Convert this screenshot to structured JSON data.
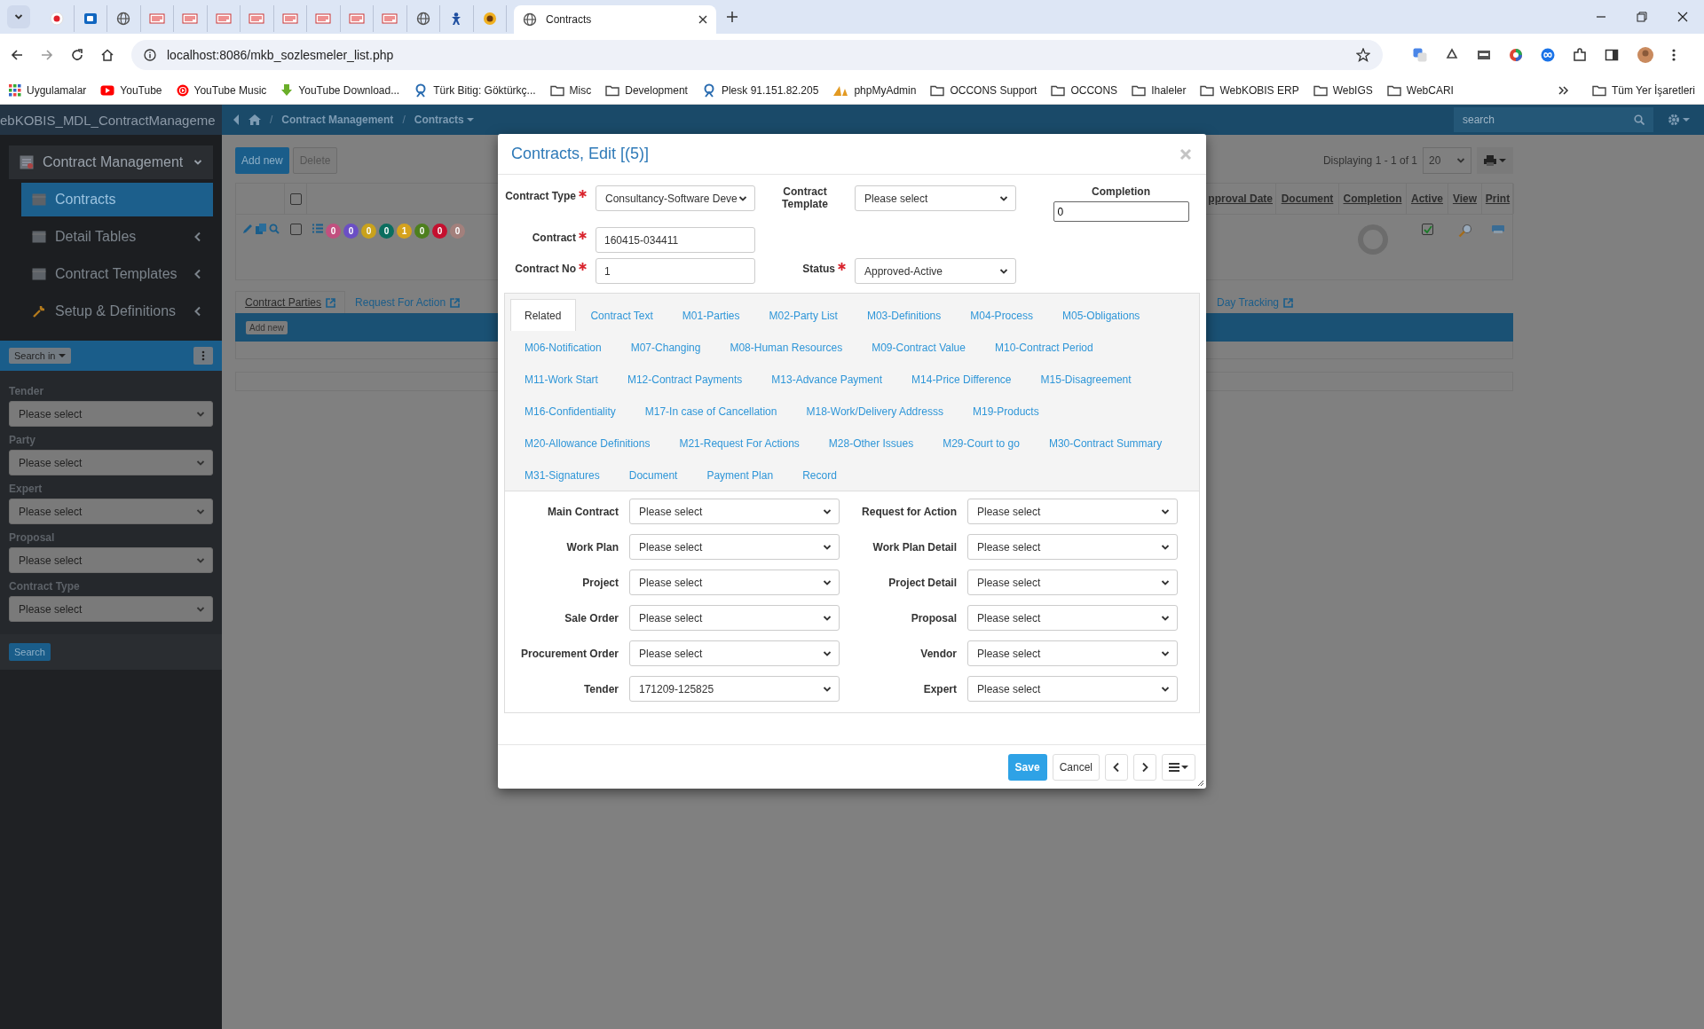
{
  "browser": {
    "tabs": [
      {
        "kind": "dot",
        "selected": false
      },
      {
        "kind": "mail",
        "selected": false
      },
      {
        "kind": "globe",
        "selected": false
      },
      {
        "kind": "logo",
        "selected": false
      },
      {
        "kind": "logo",
        "selected": false
      },
      {
        "kind": "logo",
        "selected": false
      },
      {
        "kind": "logo",
        "selected": false
      },
      {
        "kind": "logo",
        "selected": false
      },
      {
        "kind": "logo",
        "selected": false
      },
      {
        "kind": "logo",
        "selected": false
      },
      {
        "kind": "logo",
        "selected": false
      },
      {
        "kind": "globe",
        "selected": false
      },
      {
        "kind": "figure",
        "selected": false
      },
      {
        "kind": "emblem",
        "selected": false
      },
      {
        "kind": "globe",
        "title": "Contracts",
        "selected": true
      }
    ],
    "url": "localhost:8086/mkb_sozlesmeler_list.php",
    "bookmarks": [
      {
        "label": "Uygulamalar",
        "kind": "apps"
      },
      {
        "label": "YouTube",
        "kind": "video"
      },
      {
        "label": "YouTube Music",
        "kind": "music"
      },
      {
        "label": "YouTube Download...",
        "kind": "download"
      },
      {
        "label": "Türk Bitig: Göktürkç...",
        "kind": "site"
      },
      {
        "label": "Misc",
        "kind": "folder"
      },
      {
        "label": "Development",
        "kind": "folder"
      },
      {
        "label": "Plesk 91.151.82.205",
        "kind": "site"
      },
      {
        "label": "phpMyAdmin",
        "kind": "pma"
      },
      {
        "label": "OCCONS Support",
        "kind": "folder"
      },
      {
        "label": "OCCONS",
        "kind": "folder"
      },
      {
        "label": "Ihaleler",
        "kind": "folder"
      },
      {
        "label": "WebKOBIS ERP",
        "kind": "folder"
      },
      {
        "label": "WebIGS",
        "kind": "folder"
      },
      {
        "label": "WebCARI",
        "kind": "folder"
      }
    ],
    "all_bookmarks": "Tüm Yer İşaretleri"
  },
  "app": {
    "title": "ebKOBIS_MDL_ContractManageme",
    "breadcrumb": [
      "Contract Management",
      "Contracts"
    ],
    "separators": [
      "/",
      "/"
    ],
    "search": {
      "placeholder": "search"
    }
  },
  "sidebar": {
    "menu": [
      {
        "label": "Contract Management",
        "expanded": true,
        "children": [
          {
            "label": "Contracts",
            "kind": "table",
            "selected": true
          },
          {
            "label": "Detail Tables",
            "kind": "table",
            "selected": false,
            "expanded": false
          },
          {
            "label": "Contract Templates",
            "kind": "table",
            "selected": false,
            "expanded": false
          },
          {
            "label": "Setup & Definitions",
            "kind": "tool",
            "selected": false,
            "expanded": false
          }
        ]
      }
    ],
    "search_in": "Search in",
    "filters": [
      {
        "label": "Tender",
        "value": "Please select"
      },
      {
        "label": "Party",
        "value": "Please select"
      },
      {
        "label": "Expert",
        "value": "Please select"
      },
      {
        "label": "Proposal",
        "value": "Please select"
      },
      {
        "label": "Contract Type",
        "value": "Please select"
      }
    ],
    "submit": "Search"
  },
  "toolbar": {
    "buttons": [
      "Add new",
      "Delete"
    ],
    "paging": "Displaying 1 - 1 of 1",
    "page_size": "20"
  },
  "grid": {
    "header_checked": false,
    "columns": [
      "pproval Date",
      "Document",
      "Completion",
      "Active",
      "View",
      "Print"
    ],
    "row": {
      "checked": false,
      "active": true,
      "badges": [
        {
          "count": "0",
          "color": "#c1507f"
        },
        {
          "count": "0",
          "color": "#6b4fc4"
        },
        {
          "count": "0",
          "color": "#c9a21c"
        },
        {
          "count": "0",
          "color": "#0b6e5f"
        },
        {
          "count": "1",
          "color": "#d5a21e"
        },
        {
          "count": "0",
          "color": "#4d7f1e"
        },
        {
          "count": "0",
          "color": "#c4102f"
        },
        {
          "count": "0",
          "color": "#a3807c"
        }
      ]
    }
  },
  "detail_tabs": [
    {
      "label": "Contract Parties",
      "selected": true
    },
    {
      "label": "Request For Action",
      "selected": false
    },
    {
      "label": "Day Tracking",
      "selected": false
    }
  ],
  "detail_add": "Add new",
  "modal": {
    "title": "Contracts, Edit [(5)]",
    "fields": [
      {
        "label": "Contract Type",
        "required": true,
        "kind": "select",
        "value": "Consultancy-Software Deve"
      },
      {
        "label": "Contract Template",
        "required": false,
        "kind": "select",
        "value": "Please select"
      },
      {
        "label": "Completion",
        "kind": "input",
        "value": "0"
      },
      {
        "label": "Contract",
        "required": true,
        "kind": "input",
        "value": "160415-034411"
      },
      {
        "label": "Contract No",
        "required": true,
        "kind": "input",
        "value": "1"
      },
      {
        "label": "Status",
        "required": true,
        "kind": "select",
        "value": "Approved-Active"
      }
    ],
    "tabs": [
      {
        "label": "Related",
        "selected": true
      },
      {
        "label": "Contract Text",
        "selected": false
      },
      {
        "label": "M01-Parties",
        "selected": false
      },
      {
        "label": "M02-Party List",
        "selected": false
      },
      {
        "label": "M03-Definitions",
        "selected": false
      },
      {
        "label": "M04-Process",
        "selected": false
      },
      {
        "label": "M05-Obligations",
        "selected": false
      },
      {
        "label": "M06-Notification",
        "selected": false
      },
      {
        "label": "M07-Changing",
        "selected": false
      },
      {
        "label": "M08-Human Resources",
        "selected": false
      },
      {
        "label": "M09-Contract Value",
        "selected": false
      },
      {
        "label": "M10-Contract Period",
        "selected": false
      },
      {
        "label": "M11-Work Start",
        "selected": false
      },
      {
        "label": "M12-Contract Payments",
        "selected": false
      },
      {
        "label": "M13-Advance Payment",
        "selected": false
      },
      {
        "label": "M14-Price Difference",
        "selected": false
      },
      {
        "label": "M15-Disagreement",
        "selected": false
      },
      {
        "label": "M16-Confidentiality",
        "selected": false
      },
      {
        "label": "M17-In case of Cancellation",
        "selected": false
      },
      {
        "label": "M18-Work/Delivery Addresss",
        "selected": false
      },
      {
        "label": "M19-Products",
        "selected": false
      },
      {
        "label": "M20-Allowance Definitions",
        "selected": false
      },
      {
        "label": "M21-Request For Actions",
        "selected": false
      },
      {
        "label": "M28-Other Issues",
        "selected": false
      },
      {
        "label": "M29-Court to go",
        "selected": false
      },
      {
        "label": "M30-Contract Summary",
        "selected": false
      },
      {
        "label": "M31-Signatures",
        "selected": false
      },
      {
        "label": "Document",
        "selected": false
      },
      {
        "label": "Payment Plan",
        "selected": false
      },
      {
        "label": "Record",
        "selected": false
      }
    ],
    "related": [
      {
        "label": "Main Contract",
        "value": "Please select"
      },
      {
        "label": "Request for Action",
        "value": "Please select"
      },
      {
        "label": "Work Plan",
        "value": "Please select"
      },
      {
        "label": "Work Plan Detail",
        "value": "Please select"
      },
      {
        "label": "Project",
        "value": "Please select"
      },
      {
        "label": "Project Detail",
        "value": "Please select"
      },
      {
        "label": "Sale Order",
        "value": "Please select"
      },
      {
        "label": "Proposal",
        "value": "Please select"
      },
      {
        "label": "Procurement Order",
        "value": "Please select"
      },
      {
        "label": "Vendor",
        "value": "Please select"
      },
      {
        "label": "Tender",
        "value": "171209-125825"
      },
      {
        "label": "Expert",
        "value": "Please select"
      }
    ],
    "footer": {
      "save": "Save",
      "cancel": "Cancel"
    }
  }
}
